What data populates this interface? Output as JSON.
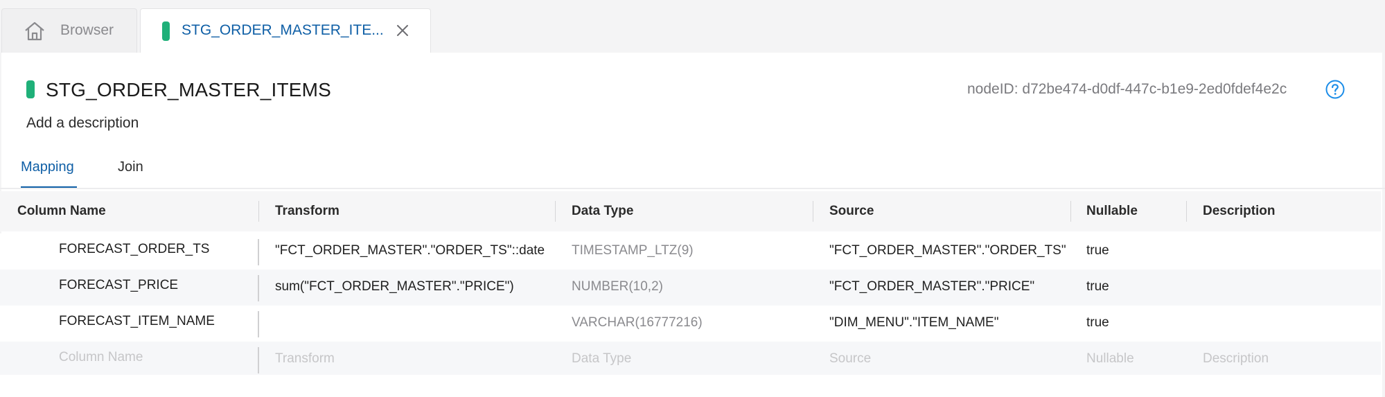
{
  "tabs": {
    "browser_label": "Browser",
    "active_label": "STG_ORDER_MASTER_ITE...",
    "browser_icon": "home-icon",
    "close_icon": "close-icon"
  },
  "node": {
    "title": "STG_ORDER_MASTER_ITEMS",
    "description_placeholder": "Add a description",
    "node_id": "nodeID: d72be474-d0df-447c-b1e9-2ed0fdef4e2c",
    "help_icon": "help-icon",
    "accent_color": "#1fb079"
  },
  "subtabs": [
    {
      "label": "Mapping",
      "active": true
    },
    {
      "label": "Join",
      "active": false
    }
  ],
  "grid": {
    "columns": [
      "Column Name",
      "Transform",
      "Data Type",
      "Source",
      "Nullable",
      "Description"
    ],
    "rows": [
      {
        "column_name": "FORECAST_ORDER_TS",
        "transform": "\"FCT_ORDER_MASTER\".\"ORDER_TS\"::date",
        "data_type": "TIMESTAMP_LTZ(9)",
        "source": "\"FCT_ORDER_MASTER\".\"ORDER_TS\"",
        "nullable": "true",
        "description": ""
      },
      {
        "column_name": "FORECAST_PRICE",
        "transform": "sum(\"FCT_ORDER_MASTER\".\"PRICE\")",
        "data_type": "NUMBER(10,2)",
        "source": "\"FCT_ORDER_MASTER\".\"PRICE\"",
        "nullable": "true",
        "description": ""
      },
      {
        "column_name": "FORECAST_ITEM_NAME",
        "transform": "",
        "data_type": "VARCHAR(16777216)",
        "source": "\"DIM_MENU\".\"ITEM_NAME\"",
        "nullable": "true",
        "description": ""
      }
    ],
    "new_row_placeholders": {
      "column_name": "Column Name",
      "transform": "Transform",
      "data_type": "Data Type",
      "source": "Source",
      "nullable": "Nullable",
      "description": "Description"
    }
  }
}
